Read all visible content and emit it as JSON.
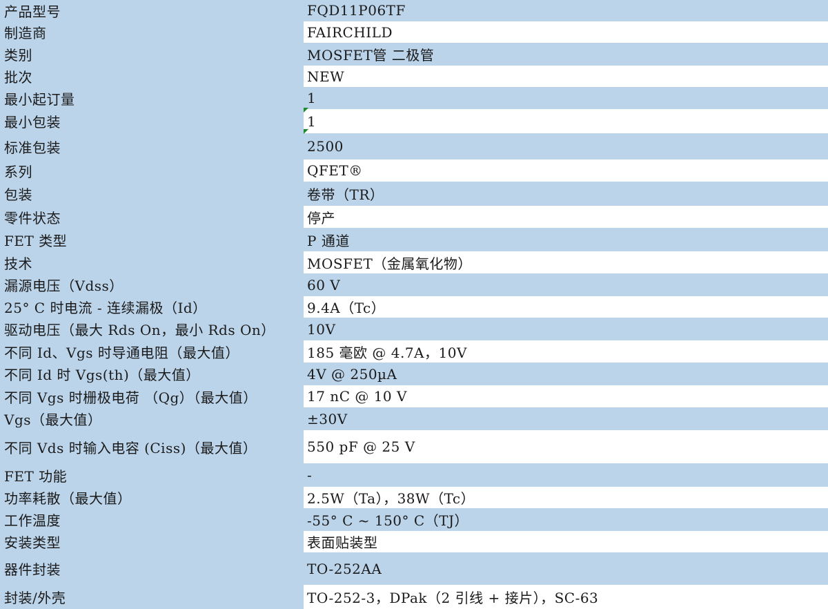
{
  "rows": [
    {
      "label": "产品型号",
      "value": "FQD11P06TF"
    },
    {
      "label": "制造商",
      "value": "FAIRCHILD"
    },
    {
      "label": "类别",
      "value": "MOSFET管 二极管"
    },
    {
      "label": "批次",
      "value": "NEW"
    },
    {
      "label": "最小起订量",
      "value": "1"
    },
    {
      "label": "最小包装",
      "value": "1"
    },
    {
      "label": "标准包装",
      "value": "2500"
    },
    {
      "label": "系列",
      "value": "QFET®"
    },
    {
      "label": "包装",
      "value": "卷带（TR）"
    },
    {
      "label": "零件状态",
      "value": "停产"
    },
    {
      "label": "FET 类型",
      "value": "P 通道"
    },
    {
      "label": "技术",
      "value": "MOSFET（金属氧化物）"
    },
    {
      "label": "漏源电压（Vdss）",
      "value": "60 V"
    },
    {
      "label": "25° C 时电流 - 连续漏极（Id）",
      "value": "9.4A（Tc）"
    },
    {
      "label": "驱动电压（最大 Rds On，最小 Rds On）",
      "value": "10V"
    },
    {
      "label": "不同 Id、Vgs 时导通电阻（最大值）",
      "value": "185 毫欧 @ 4.7A，10V"
    },
    {
      "label": "不同 Id 时 Vgs(th)（最大值）",
      "value": "4V @ 250µA"
    },
    {
      "label": "不同 Vgs 时栅极电荷 （Qg）（最大值）",
      "value": "17 nC @ 10 V"
    },
    {
      "label": "Vgs（最大值）",
      "value": "±30V"
    },
    {
      "label": "不同 Vds 时输入电容 (Ciss)（最大值）",
      "value": "550 pF @ 25 V"
    },
    {
      "label": "FET 功能",
      "value": "-"
    },
    {
      "label": "功率耗散（最大值）",
      "value": "2.5W（Ta），38W（Tc）"
    },
    {
      "label": "工作温度",
      "value": "-55° C ~ 150° C（TJ）"
    },
    {
      "label": "安装类型",
      "value": "表面贴装型"
    },
    {
      "label": "器件封装",
      "value": "TO-252AA"
    },
    {
      "label": "封装/外壳",
      "value": "TO-252-3，DPak（2 引线 + 接片），SC-63"
    }
  ]
}
